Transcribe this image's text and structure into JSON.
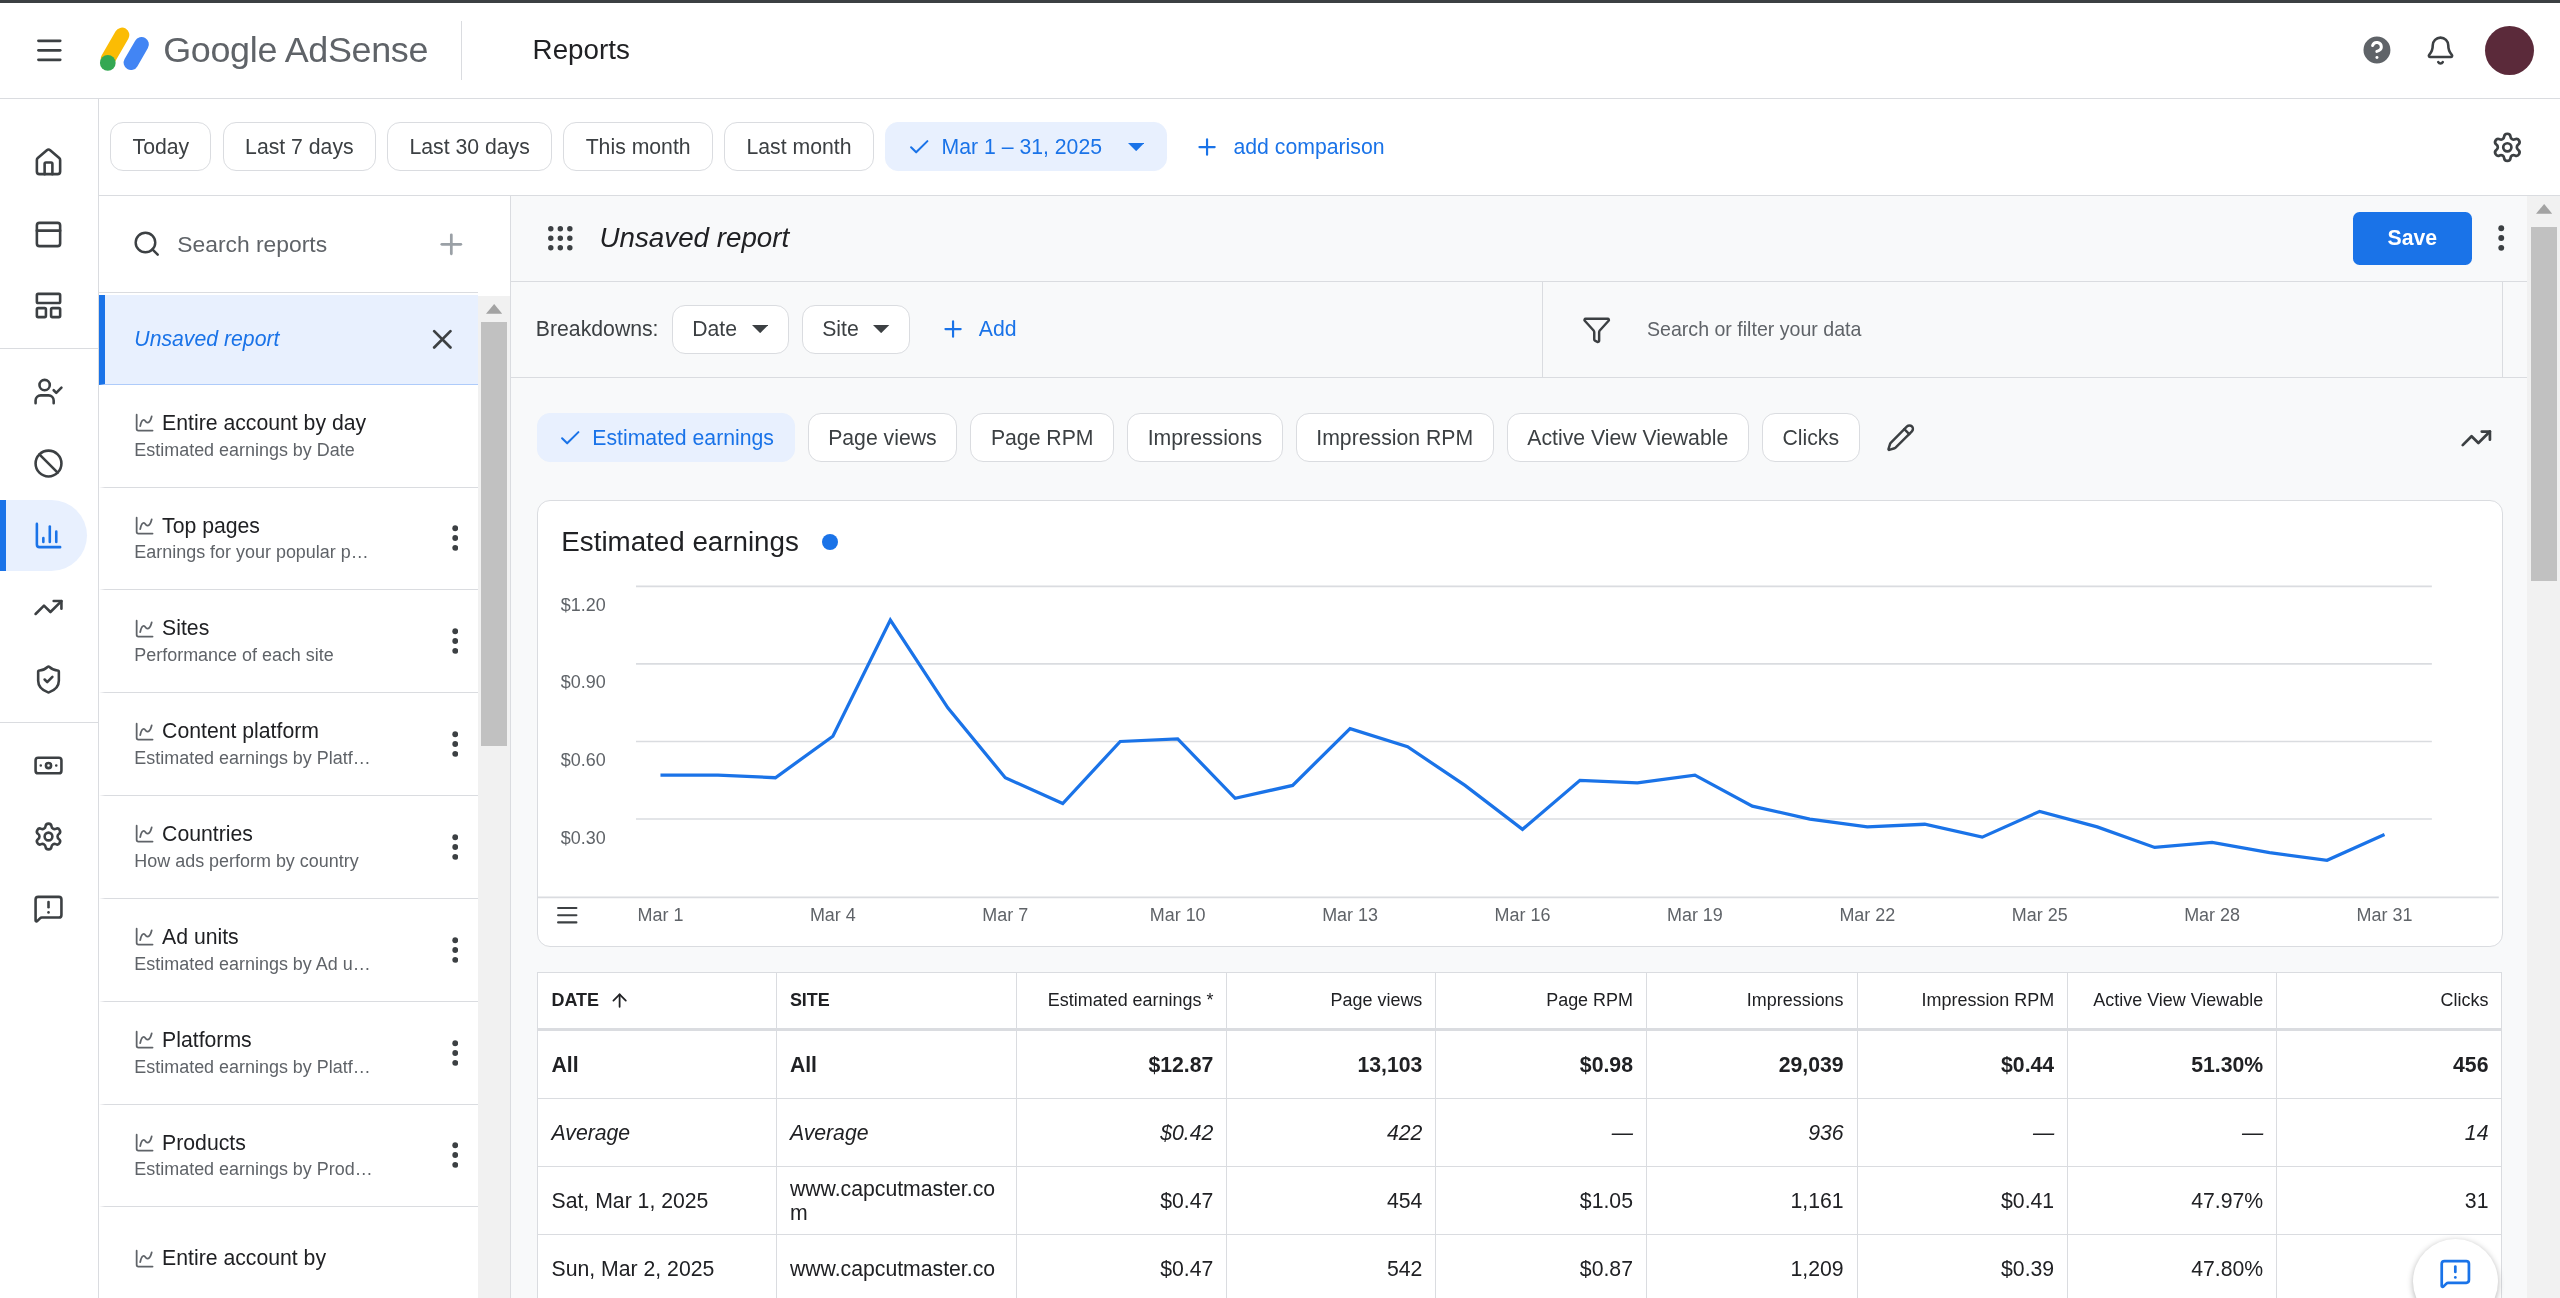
{
  "header": {
    "product_name": "Google AdSense",
    "page_title": "Reports"
  },
  "nav_rail": [
    {
      "selected": false
    },
    {
      "selected": false
    },
    {
      "selected": false
    },
    {
      "selected": false
    },
    {
      "selected": false
    },
    {
      "selected": true
    },
    {
      "selected": false
    },
    {
      "selected": false
    },
    {
      "selected": false
    },
    {
      "selected": false
    },
    {
      "selected": false
    }
  ],
  "date_range": {
    "presets": [
      {
        "label": "Today",
        "selected": false
      },
      {
        "label": "Last 7 days",
        "selected": false
      },
      {
        "label": "Last 30 days",
        "selected": false
      },
      {
        "label": "This month",
        "selected": false
      },
      {
        "label": "Last month",
        "selected": false
      },
      {
        "label": "Mar 1 – 31, 2025",
        "selected": true
      }
    ],
    "add_comparison": "add comparison"
  },
  "report_list": {
    "search_placeholder": "Search reports",
    "items": [
      {
        "title": "Unsaved report",
        "selected": true
      },
      {
        "title": "Entire account by day",
        "subtitle": "Estimated earnings by Date",
        "selected": false,
        "menu": false
      },
      {
        "title": "Top pages",
        "subtitle": "Earnings for your popular p…",
        "selected": false,
        "menu": true
      },
      {
        "title": "Sites",
        "subtitle": "Performance of each site",
        "selected": false,
        "menu": true
      },
      {
        "title": "Content platform",
        "subtitle": "Estimated earnings by Platf…",
        "selected": false,
        "menu": true
      },
      {
        "title": "Countries",
        "subtitle": "How ads perform by country",
        "selected": false,
        "menu": true
      },
      {
        "title": "Ad units",
        "subtitle": "Estimated earnings by Ad u…",
        "selected": false,
        "menu": true
      },
      {
        "title": "Platforms",
        "subtitle": "Estimated earnings by Platf…",
        "selected": false,
        "menu": true
      },
      {
        "title": "Products",
        "subtitle": "Estimated earnings by Prod…",
        "selected": false,
        "menu": true
      },
      {
        "title": "Entire account by",
        "selected": false,
        "menu": false
      }
    ]
  },
  "report": {
    "title": "Unsaved report",
    "save": "Save",
    "breakdowns_label": "Breakdowns:",
    "breakdowns": [
      "Date",
      "Site"
    ],
    "add": "Add",
    "filter_placeholder": "Search or filter your data",
    "metrics": [
      {
        "label": "Estimated earnings",
        "selected": true
      },
      {
        "label": "Page views",
        "selected": false
      },
      {
        "label": "Page RPM",
        "selected": false
      },
      {
        "label": "Impressions",
        "selected": false
      },
      {
        "label": "Impression RPM",
        "selected": false
      },
      {
        "label": "Active View Viewable",
        "selected": false
      },
      {
        "label": "Clicks",
        "selected": false
      }
    ],
    "chart": {
      "chart_data": {
        "type": "line",
        "title": "Estimated earnings",
        "categories": [
          "Mar 1",
          null,
          null,
          "Mar 4",
          null,
          null,
          "Mar 7",
          null,
          null,
          "Mar 10",
          null,
          null,
          "Mar 13",
          null,
          null,
          "Mar 16",
          null,
          null,
          "Mar 19",
          null,
          null,
          "Mar 22",
          null,
          null,
          "Mar 25",
          null,
          null,
          "Mar 28",
          null,
          null,
          "Mar 31"
        ],
        "series": [
          {
            "color": "#1a73e8",
            "values": [
              0.47,
              0.47,
              0.46,
              0.62,
              1.07,
              0.73,
              0.46,
              0.36,
              0.6,
              0.61,
              0.38,
              0.43,
              0.65,
              0.58,
              0.43,
              0.26,
              0.45,
              0.44,
              0.47,
              0.35,
              0.3,
              0.27,
              0.28,
              0.23,
              0.33,
              0.27,
              0.19,
              0.21,
              0.17,
              0.14,
              0.24
            ]
          }
        ],
        "ylim": [
          0,
          1.2
        ],
        "grid": true,
        "yticks": [
          {
            "value": 0.3,
            "label": "$0.30"
          },
          {
            "value": 0.6,
            "label": "$0.60"
          },
          {
            "value": 0.9,
            "label": "$0.90"
          },
          {
            "value": 1.2,
            "label": "$1.20"
          }
        ]
      }
    },
    "table": {
      "columns": [
        {
          "label": "DATE",
          "sorted": true
        },
        {
          "label": "SITE",
          "sorted": false
        },
        {
          "label": "Estimated earnings *",
          "sorted": false
        },
        {
          "label": "Page views",
          "sorted": false
        },
        {
          "label": "Page RPM",
          "sorted": false
        },
        {
          "label": "Impressions",
          "sorted": false
        },
        {
          "label": "Impression RPM",
          "sorted": false
        },
        {
          "label": "Active View Viewable",
          "sorted": false
        },
        {
          "label": "Clicks",
          "sorted": false
        }
      ],
      "rows": [
        {
          "kind": "total",
          "cells": [
            "All",
            "All",
            "$12.87",
            "13,103",
            "$0.98",
            "29,039",
            "$0.44",
            "51.30%",
            "456"
          ]
        },
        {
          "kind": "average",
          "cells": [
            "Average",
            "Average",
            "$0.42",
            "422",
            "—",
            "936",
            "—",
            "—",
            "14"
          ]
        },
        {
          "kind": "day",
          "cells": [
            "Sat, Mar 1, 2025",
            "www.capcutmaster.com",
            "$0.47",
            "454",
            "$1.05",
            "1,161",
            "$0.41",
            "47.97%",
            "31"
          ]
        },
        {
          "kind": "day",
          "cells": [
            "Sun, Mar 2, 2025",
            "www.capcutmaster.co",
            "$0.47",
            "542",
            "$0.87",
            "1,209",
            "$0.39",
            "47.80%",
            null
          ]
        }
      ]
    }
  }
}
